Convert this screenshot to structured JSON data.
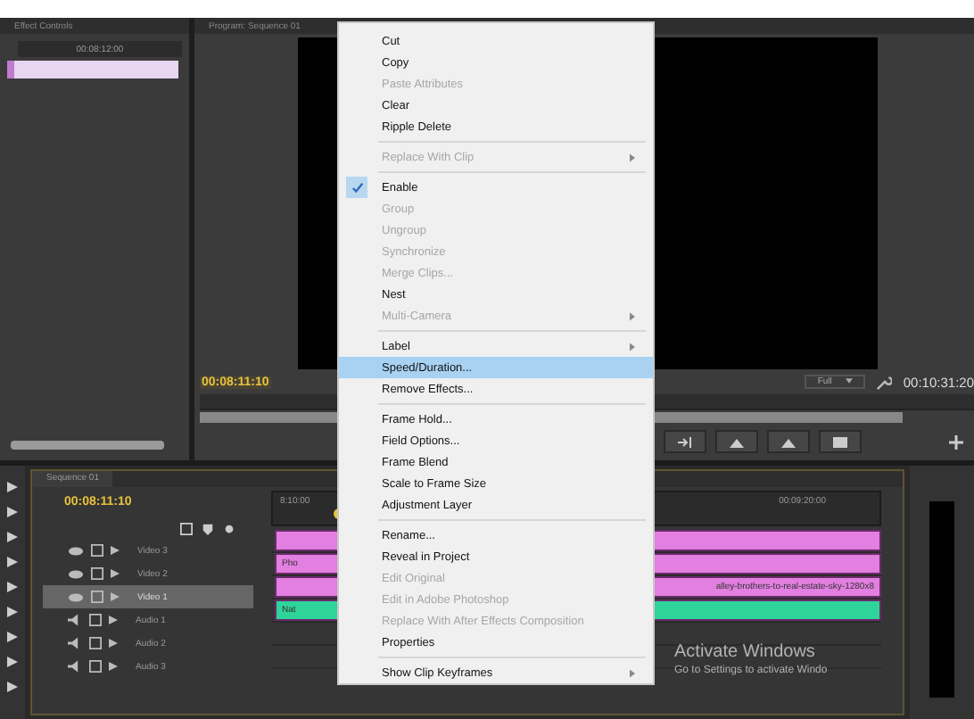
{
  "source_panel": {
    "title": "Effect Controls",
    "timecode": "00:08:12:00"
  },
  "program": {
    "title": "Program: Sequence 01",
    "timecode": "00:08:11:10",
    "zoom": "Full",
    "duration": "00:10:31:20"
  },
  "timeline": {
    "tab": "Sequence 01",
    "timecode": "00:08:11:10",
    "ruler_start": "8:10:00",
    "ruler_end": "00:09:20:00",
    "tracks": [
      {
        "name": "Video 3",
        "kind": "video",
        "selected": false,
        "clip": {
          "color": "#e27fe0"
        }
      },
      {
        "name": "Video 2",
        "kind": "video",
        "selected": false,
        "clip": {
          "label": "Pho",
          "color": "#e27fe0",
          "label_at_end": false
        }
      },
      {
        "name": "Video 1",
        "kind": "video",
        "selected": true,
        "clip": {
          "label": "alley-brothers-to-real-estate-sky-1280x8",
          "color": "#e27fe0",
          "label_at_end": true
        }
      },
      {
        "name": "Audio 1",
        "kind": "audio",
        "selected": false,
        "clip": {
          "label": "Nat",
          "color": "#2fd49a",
          "label_at_end": false
        }
      },
      {
        "name": "Audio 2",
        "kind": "audio",
        "selected": false
      },
      {
        "name": "Audio 3",
        "kind": "audio",
        "selected": false
      }
    ]
  },
  "context_menu": [
    {
      "label": "Cut",
      "disabled": false
    },
    {
      "label": "Copy",
      "disabled": false
    },
    {
      "label": "Paste Attributes",
      "disabled": true
    },
    {
      "label": "Clear",
      "disabled": false
    },
    {
      "label": "Ripple Delete",
      "disabled": false,
      "separator_after": true
    },
    {
      "label": "Replace With Clip",
      "disabled": true,
      "submenu": true,
      "separator_after": true
    },
    {
      "label": "Enable",
      "disabled": false,
      "checked": true
    },
    {
      "label": "Group",
      "disabled": true
    },
    {
      "label": "Ungroup",
      "disabled": true
    },
    {
      "label": "Synchronize",
      "disabled": true
    },
    {
      "label": "Merge Clips...",
      "disabled": true
    },
    {
      "label": "Nest",
      "disabled": false
    },
    {
      "label": "Multi-Camera",
      "disabled": true,
      "submenu": true,
      "separator_after": true
    },
    {
      "label": "Label",
      "disabled": false,
      "submenu": true
    },
    {
      "label": "Speed/Duration...",
      "disabled": false,
      "selected": true
    },
    {
      "label": "Remove Effects...",
      "disabled": false,
      "separator_after": true
    },
    {
      "label": "Frame Hold...",
      "disabled": false
    },
    {
      "label": "Field Options...",
      "disabled": false
    },
    {
      "label": "Frame Blend",
      "disabled": false
    },
    {
      "label": "Scale to Frame Size",
      "disabled": false
    },
    {
      "label": "Adjustment Layer",
      "disabled": false,
      "separator_after": true
    },
    {
      "label": "Rename...",
      "disabled": false
    },
    {
      "label": "Reveal in Project",
      "disabled": false
    },
    {
      "label": "Edit Original",
      "disabled": true
    },
    {
      "label": "Edit in Adobe Photoshop",
      "disabled": true
    },
    {
      "label": "Replace With After Effects Composition",
      "disabled": true
    },
    {
      "label": "Properties",
      "disabled": false,
      "separator_after": true
    },
    {
      "label": "Show Clip Keyframes",
      "disabled": false,
      "submenu": true
    }
  ],
  "os_notice": {
    "title": "Activate Windows",
    "message": "Go to Settings to activate Windo"
  }
}
